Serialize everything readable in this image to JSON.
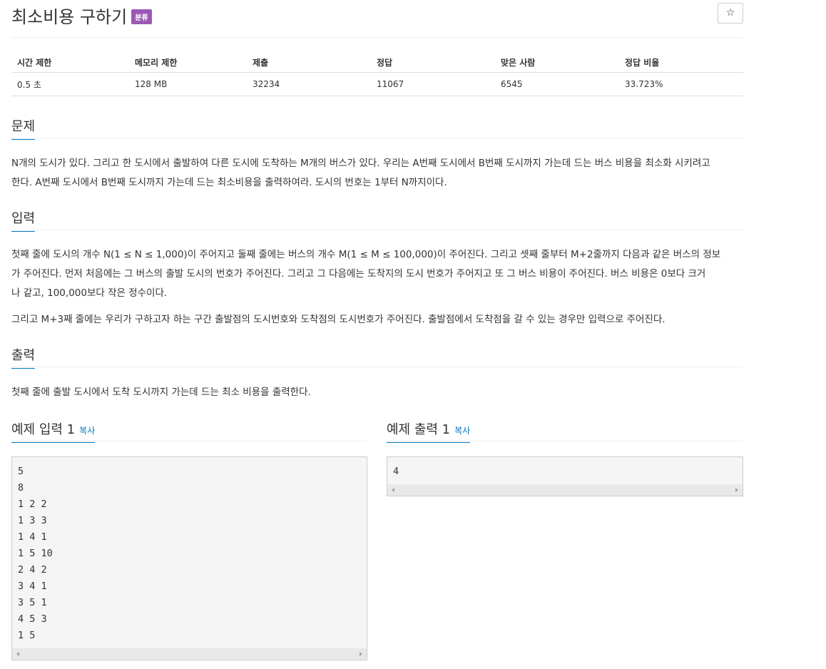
{
  "problem": {
    "title": "최소비용 구하기",
    "badge": "분류",
    "star": "☆"
  },
  "info_table": {
    "headers": [
      "시간 제한",
      "메모리 제한",
      "제출",
      "정답",
      "맞은 사람",
      "정답 비율"
    ],
    "row": [
      "0.5 초",
      "128 MB",
      "32234",
      "11067",
      "6545",
      "33.723%"
    ]
  },
  "sections": {
    "description": {
      "heading": "문제",
      "lines": [
        "N개의 도시가 있다. 그리고 한 도시에서 출발하여 다른 도시에 도착하는 M개의 버스가 있다. 우리는 A번째 도시에서 B번째 도시까지 가는데 드는 버스 비용을 최소화 시키려고",
        "한다. A번째 도시에서 B번째 도시까지 가는데 드는 최소비용을 출력하여라. 도시의 번호는 1부터 N까지이다."
      ]
    },
    "input": {
      "heading": "입력",
      "lines": [
        "첫째 줄에 도시의 개수 N(1 ≤ N ≤ 1,000)이 주어지고 둘째 줄에는 버스의 개수 M(1 ≤ M ≤ 100,000)이 주어진다. 그리고 셋째 줄부터 M+2줄까지 다음과 같은 버스의 정보",
        "가 주어진다. 먼저 처음에는 그 버스의 출발 도시의 번호가 주어진다. 그리고 그 다음에는 도착지의 도시 번호가 주어지고 또 그 버스 비용이 주어진다. 버스 비용은 0보다 크거",
        "나 같고, 100,000보다 작은 정수이다."
      ],
      "line2": "그리고 M+3째 줄에는 우리가 구하고자 하는 구간 출발점의 도시번호와 도착점의 도시번호가 주어진다. 출발점에서 도착점을 갈 수 있는 경우만 입력으로 주어진다."
    },
    "output": {
      "heading": "출력",
      "text": "첫째 줄에 출발 도시에서 도착 도시까지 가는데 드는 최소 비용을 출력한다."
    }
  },
  "sample_input": {
    "heading": "예제 입력 1",
    "copy": "복사",
    "lines": [
      "5",
      "8",
      "1 2 2",
      "1 3 3",
      "1 4 1",
      "1 5 10",
      "2 4 2",
      "3 4 1",
      "3 5 1",
      "4 5 3",
      "1 5"
    ]
  },
  "sample_output": {
    "heading": "예제 출력 1",
    "copy": "복사",
    "lines": [
      "4"
    ]
  }
}
